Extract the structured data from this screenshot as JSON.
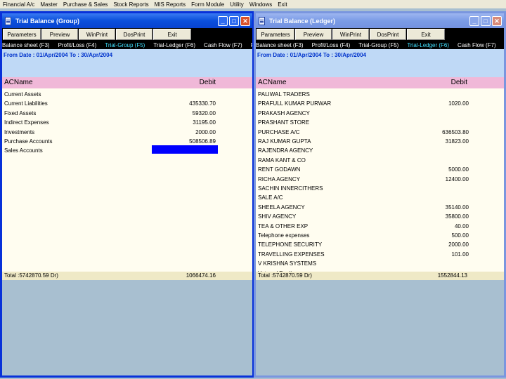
{
  "menubar": [
    "Financial A/c",
    "Master",
    "Purchase & Sales",
    "Stock Reports",
    "MIS Reports",
    "Form Module",
    "Utility",
    "Windows",
    "Exit"
  ],
  "group_window": {
    "title": "Trial Balance (Group)",
    "toolbar": [
      "Parameters",
      "Preview",
      "WinPrint",
      "DosPrint",
      "Exit"
    ],
    "fkeys": [
      {
        "label": "Balance sheet (F3)",
        "highlight": false
      },
      {
        "label": "Profit/Loss (F4)",
        "highlight": false
      },
      {
        "label": "Trial-Group (F5)",
        "highlight": true
      },
      {
        "label": "Trial-Ledger (F6)",
        "highlight": false
      },
      {
        "label": "Cash Flow (F7)",
        "highlight": false
      },
      {
        "label": "Fund",
        "highlight": false
      }
    ],
    "date_range": "From Date : 01/Apr/2004 To : 30/Apr/2004",
    "columns": {
      "name": "ACName",
      "debit": "Debit"
    },
    "rows": [
      {
        "name": "Current Assets",
        "debit": ""
      },
      {
        "name": "Current Liabilities",
        "debit": "435330.70"
      },
      {
        "name": "Fixed Assets",
        "debit": "59320.00"
      },
      {
        "name": "Indirect Expenses",
        "debit": "31195.00"
      },
      {
        "name": "Investments",
        "debit": "2000.00"
      },
      {
        "name": "Purchase Accounts",
        "debit": "508506.89"
      },
      {
        "name": "Sales Accounts",
        "debit": ""
      }
    ],
    "total_label": "Total :5742870.59 Dr)",
    "total_value": "1066474.16"
  },
  "ledger_window": {
    "title": "Trial Balance (Ledger)",
    "toolbar": [
      "Parameters",
      "Preview",
      "WinPrint",
      "DosPrint",
      "Exit"
    ],
    "fkeys": [
      {
        "label": "Balance sheet (F3)",
        "highlight": false
      },
      {
        "label": "Profit/Loss (F4)",
        "highlight": false
      },
      {
        "label": "Trial-Group (F5)",
        "highlight": false
      },
      {
        "label": "Trial-Ledger (F6)",
        "highlight": true
      },
      {
        "label": "Cash Flow (F7)",
        "highlight": false
      },
      {
        "label": "Fund",
        "highlight": false
      }
    ],
    "date_range": "From Date : 01/Apr/2004 To : 30/Apr/2004",
    "columns": {
      "name": "ACName",
      "debit": "Debit"
    },
    "rows": [
      {
        "name": "PALIWAL TRADERS",
        "debit": ""
      },
      {
        "name": "PRAFULL KUMAR PURWAR",
        "debit": "1020.00"
      },
      {
        "name": "PRAKASH AGENCY",
        "debit": ""
      },
      {
        "name": "PRASHANT STORE",
        "debit": ""
      },
      {
        "name": "PURCHASE A/C",
        "debit": "636503.80"
      },
      {
        "name": "RAJ KUMAR GUPTA",
        "debit": "31823.00"
      },
      {
        "name": "RAJENDRA AGENCY",
        "debit": ""
      },
      {
        "name": "RAMA KANT & CO",
        "debit": ""
      },
      {
        "name": "RENT GODAWN",
        "debit": "5000.00"
      },
      {
        "name": "RICHA AGENCY",
        "debit": "12400.00"
      },
      {
        "name": "SACHIN INNERCITHERS",
        "debit": ""
      },
      {
        "name": "SALE A/C",
        "debit": ""
      },
      {
        "name": "SHEELA AGENCY",
        "debit": "35140.00"
      },
      {
        "name": "SHIV AGENCY",
        "debit": "35800.00"
      },
      {
        "name": "TEA & OTHER EXP",
        "debit": "40.00"
      },
      {
        "name": "Telephone expenses",
        "debit": "500.00"
      },
      {
        "name": "TELEPHONE SECURITY",
        "debit": "2000.00"
      },
      {
        "name": "TRAVELLING EXPENSES",
        "debit": "101.00"
      },
      {
        "name": "V KRISHNA SYSTEMS",
        "debit": ""
      },
      {
        "name": "Vatsrcol Trading",
        "debit": ""
      }
    ],
    "total_label": "Total :5742870.59 Dr)",
    "total_value": "1552844.13"
  }
}
